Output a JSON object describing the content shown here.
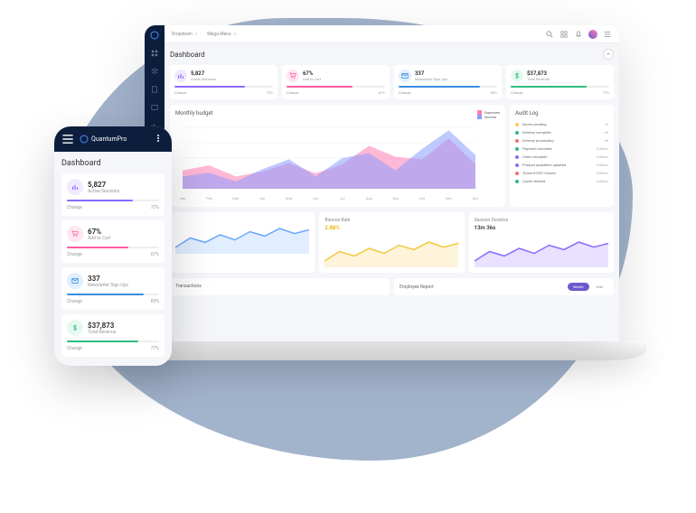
{
  "brand": "QuantumPro",
  "page_title": "Dashboard",
  "topbar": {
    "dropdown_label": "Dropdown",
    "mega_menu_label": "Mega Menu"
  },
  "stats": [
    {
      "icon": "bars-icon",
      "icon_bg": "#f0eaff",
      "icon_color": "#8a6aff",
      "value": "5,827",
      "label": "Active Sessions",
      "change_label": "Change",
      "pct": "72%",
      "bar_pct": 72,
      "bar_color": "#8a6aff"
    },
    {
      "icon": "cart-icon",
      "icon_bg": "#ffe6f0",
      "icon_color": "#ff5ca0",
      "value": "67%",
      "label": "Add to Cart",
      "change_label": "Change",
      "pct": "67%",
      "bar_pct": 67,
      "bar_color": "#ff5ca0"
    },
    {
      "icon": "mail-icon",
      "icon_bg": "#e0f0ff",
      "icon_color": "#3a8de0",
      "value": "337",
      "label": "Newsletter Sign Ups",
      "change_label": "Change",
      "pct": "83%",
      "bar_pct": 83,
      "bar_color": "#3a8de0"
    },
    {
      "icon": "dollar-icon",
      "icon_bg": "#e6f9f0",
      "icon_color": "#2dbd7f",
      "value": "$37,873",
      "label": "Total Revenue",
      "change_label": "Change",
      "pct": "77%",
      "bar_pct": 77,
      "bar_color": "#2dbd7f"
    }
  ],
  "monthly_budget": {
    "title": "Monthly budget",
    "legend": [
      {
        "label": "Expenses",
        "color": "#ff7eb3"
      },
      {
        "label": "Income",
        "color": "#8a9cff"
      }
    ],
    "months": [
      "Jan",
      "Feb",
      "Mar",
      "Apr",
      "May",
      "Jun",
      "Jul",
      "Aug",
      "Sep",
      "Oct",
      "Nov",
      "Dec"
    ]
  },
  "audit_log": {
    "title": "Audit Log",
    "items": [
      {
        "color": "#ffc94a",
        "text": "Server pending",
        "time": "1h"
      },
      {
        "color": "#2dbd7f",
        "text": "Delivery complete",
        "time": "2h"
      },
      {
        "color": "#ff6a6a",
        "text": "Delivery processing",
        "time": "3h"
      },
      {
        "color": "#2dbd7f",
        "text": "Payment recorded",
        "time": "0:30am"
      },
      {
        "color": "#8a6aff",
        "text": "Order complete",
        "time": "6:00am"
      },
      {
        "color": "#8a6aff",
        "text": "Product quantities updated",
        "time": "6:00am"
      },
      {
        "color": "#ff6a6a",
        "text": "Ticket #7037 Closed",
        "time": "6:00am"
      },
      {
        "color": "#2dbd7f",
        "text": "Cache cleared",
        "time": "6:00am"
      }
    ]
  },
  "mini_charts": [
    {
      "title": "",
      "value": "",
      "color": "#6aa8ff"
    },
    {
      "title": "Bounce Rate",
      "value": "2.88%",
      "value_color": "#eab308",
      "color": "#f5c842"
    },
    {
      "title": "Session Duration",
      "value": "13m 36s",
      "value_color": "#333",
      "color": "#8a6aff"
    }
  ],
  "transactions": {
    "title": "Transactions"
  },
  "employee_report": {
    "title": "Employee Report",
    "tab_primary": "Month",
    "tab_secondary": "Year"
  },
  "chart_data": {
    "type": "area",
    "title": "Monthly budget",
    "categories": [
      "Jan",
      "Feb",
      "Mar",
      "Apr",
      "May",
      "Jun",
      "Jul",
      "Aug",
      "Sep",
      "Oct",
      "Nov",
      "Dec"
    ],
    "series": [
      {
        "name": "Expenses",
        "color": "#ff7eb3",
        "values": [
          30,
          38,
          20,
          28,
          42,
          25,
          40,
          70,
          52,
          48,
          82,
          40
        ]
      },
      {
        "name": "Income",
        "color": "#8a9cff",
        "values": [
          20,
          26,
          12,
          32,
          48,
          20,
          50,
          58,
          30,
          65,
          95,
          55
        ]
      }
    ],
    "ylim": [
      0,
      100
    ]
  }
}
